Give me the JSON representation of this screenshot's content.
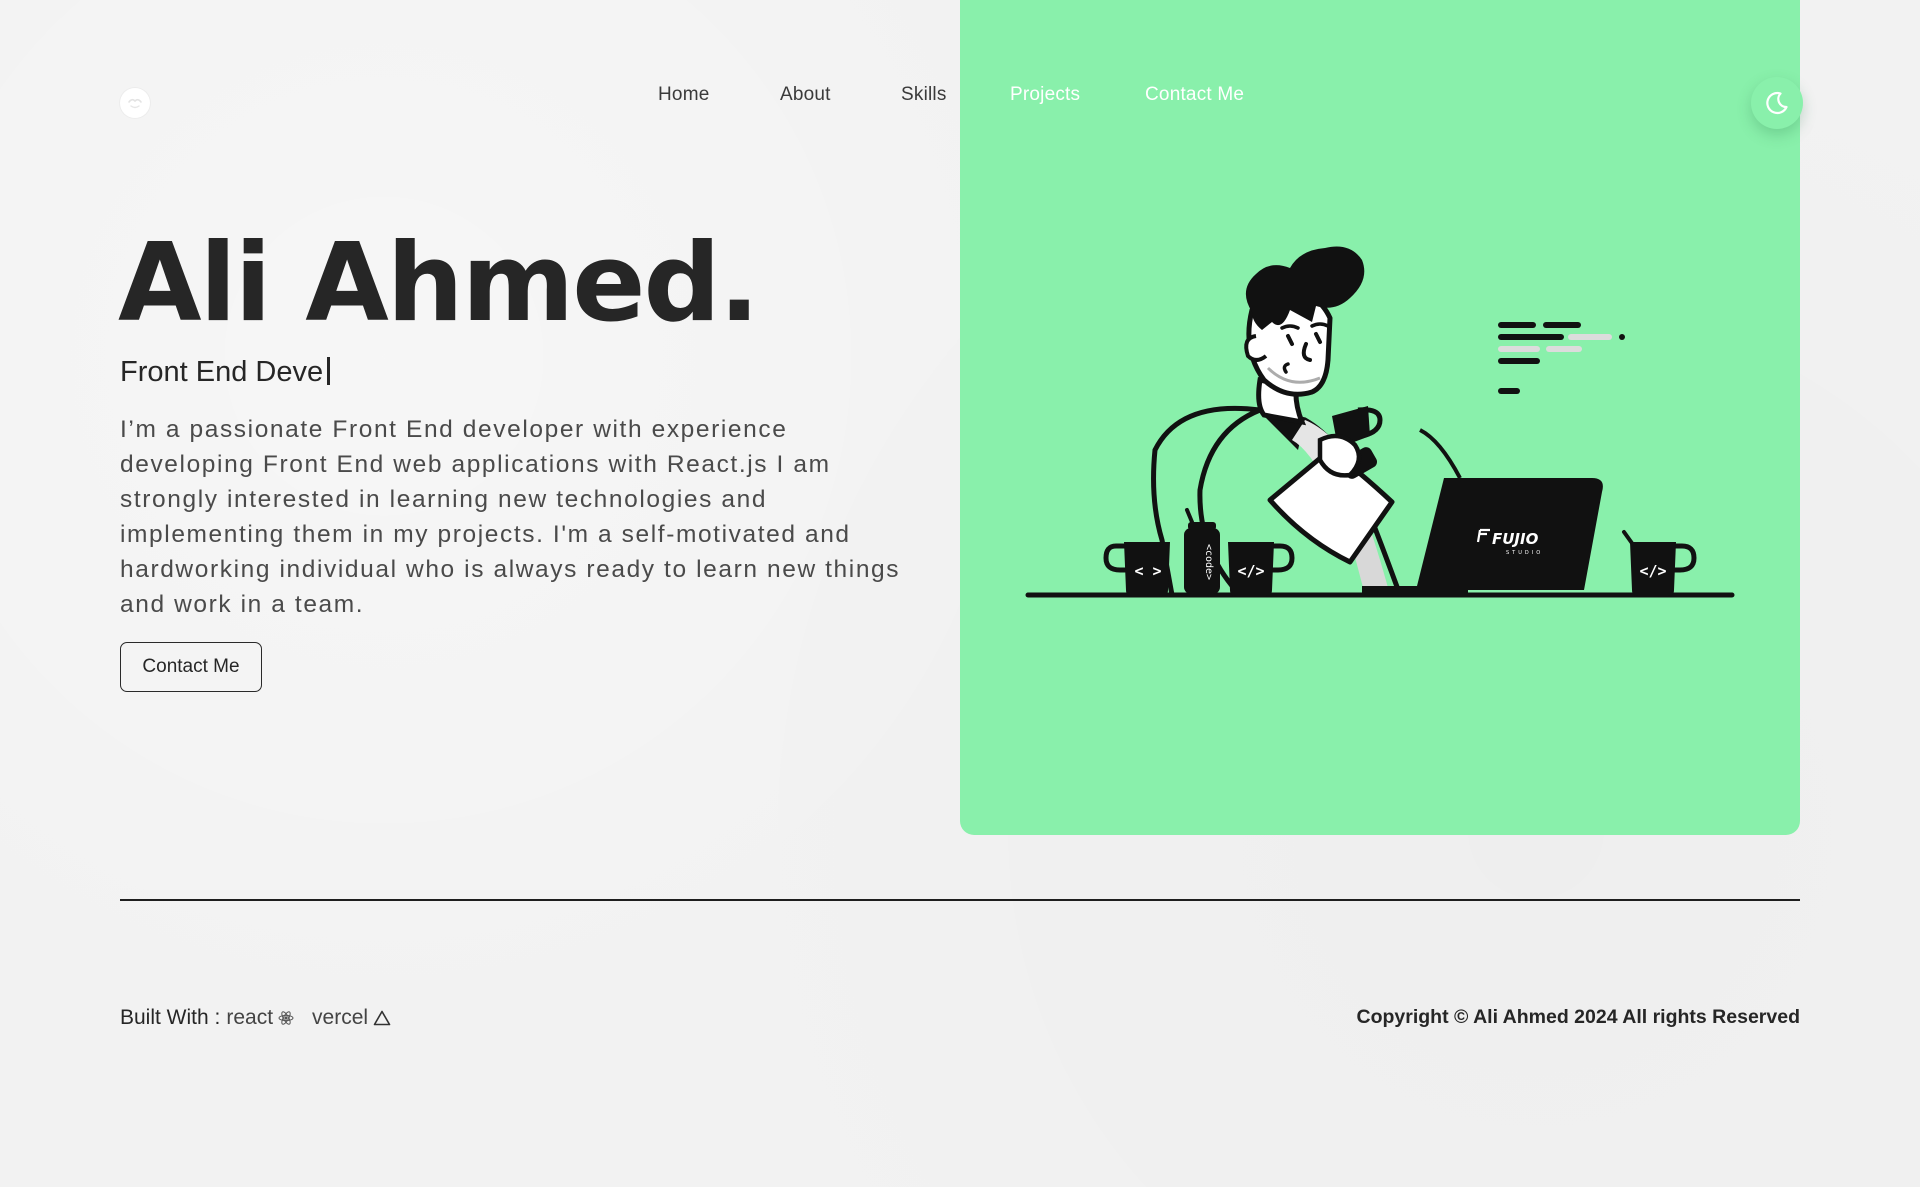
{
  "nav": {
    "items": [
      {
        "label": "Home"
      },
      {
        "label": "About"
      },
      {
        "label": "Skills"
      },
      {
        "label": "Projects"
      },
      {
        "label": "Contact Me"
      }
    ]
  },
  "hero": {
    "name": "Ali Ahmed.",
    "role_typed": "Front End Deve",
    "bio": "I’m a passionate Front End developer with experience developing Front End web applications with React.js I am strongly interested in learning new technologies and implementing them in my projects. I'm a self-motivated and hardworking individual who is always ready to learn new things and work in a team.",
    "cta_label": "Contact Me",
    "laptop_brand": "FUJIO",
    "laptop_sub": "STUDIO",
    "can_label": "<code>",
    "mug_labels": [
      "< >",
      "</>",
      "</>"
    ]
  },
  "footer": {
    "built_with_label": "Built With :",
    "tech": [
      {
        "name": "react",
        "icon": "react-icon"
      },
      {
        "name": "vercel",
        "icon": "vercel-icon"
      }
    ],
    "copyright": "Copyright © Ali Ahmed 2024 All rights Reserved"
  },
  "colors": {
    "accent": "#89f0ab",
    "background": "#f2f2f2",
    "text": "#262626"
  },
  "icons": {
    "logo": "logo-icon",
    "theme_toggle": "moon-icon"
  }
}
